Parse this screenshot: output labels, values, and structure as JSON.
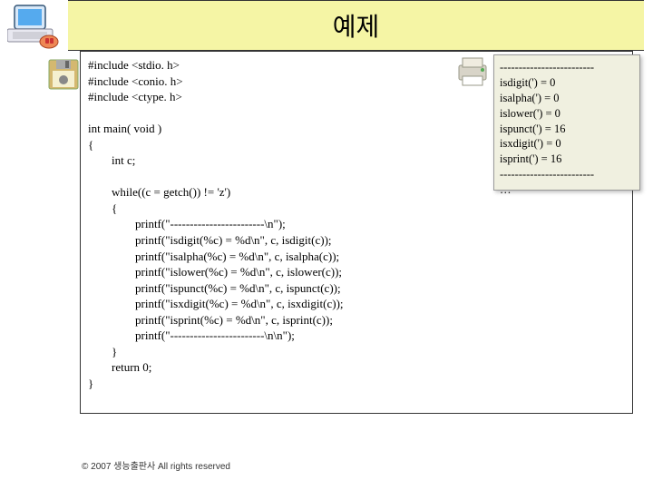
{
  "title": "예제",
  "code_lines": [
    "#include <stdio. h>",
    "#include <conio. h>",
    "#include <ctype. h>",
    "",
    "int main( void )",
    "{",
    "        int c;",
    "",
    "        while((c = getch()) != 'z')",
    "        {",
    "                printf(\"------------------------\\n\");",
    "                printf(\"isdigit(%c) = %d\\n\", c, isdigit(c));",
    "                printf(\"isalpha(%c) = %d\\n\", c, isalpha(c));",
    "                printf(\"islower(%c) = %d\\n\", c, islower(c));",
    "                printf(\"ispunct(%c) = %d\\n\", c, ispunct(c));",
    "                printf(\"isxdigit(%c) = %d\\n\", c, isxdigit(c));",
    "                printf(\"isprint(%c) = %d\\n\", c, isprint(c));",
    "                printf(\"------------------------\\n\\n\");",
    "        }",
    "        return 0;",
    "}"
  ],
  "output_lines": [
    "-------------------------",
    "isdigit(') = 0",
    "isalpha(') = 0",
    "islower(') = 0",
    "ispunct(') = 16",
    "isxdigit(') = 0",
    "isprint(') = 16",
    "-------------------------",
    "…"
  ],
  "footer": "© 2007 생능출판사  All rights reserved",
  "icons": {
    "computer": "computer-icon",
    "floppy": "floppy-icon",
    "printer": "printer-icon"
  }
}
